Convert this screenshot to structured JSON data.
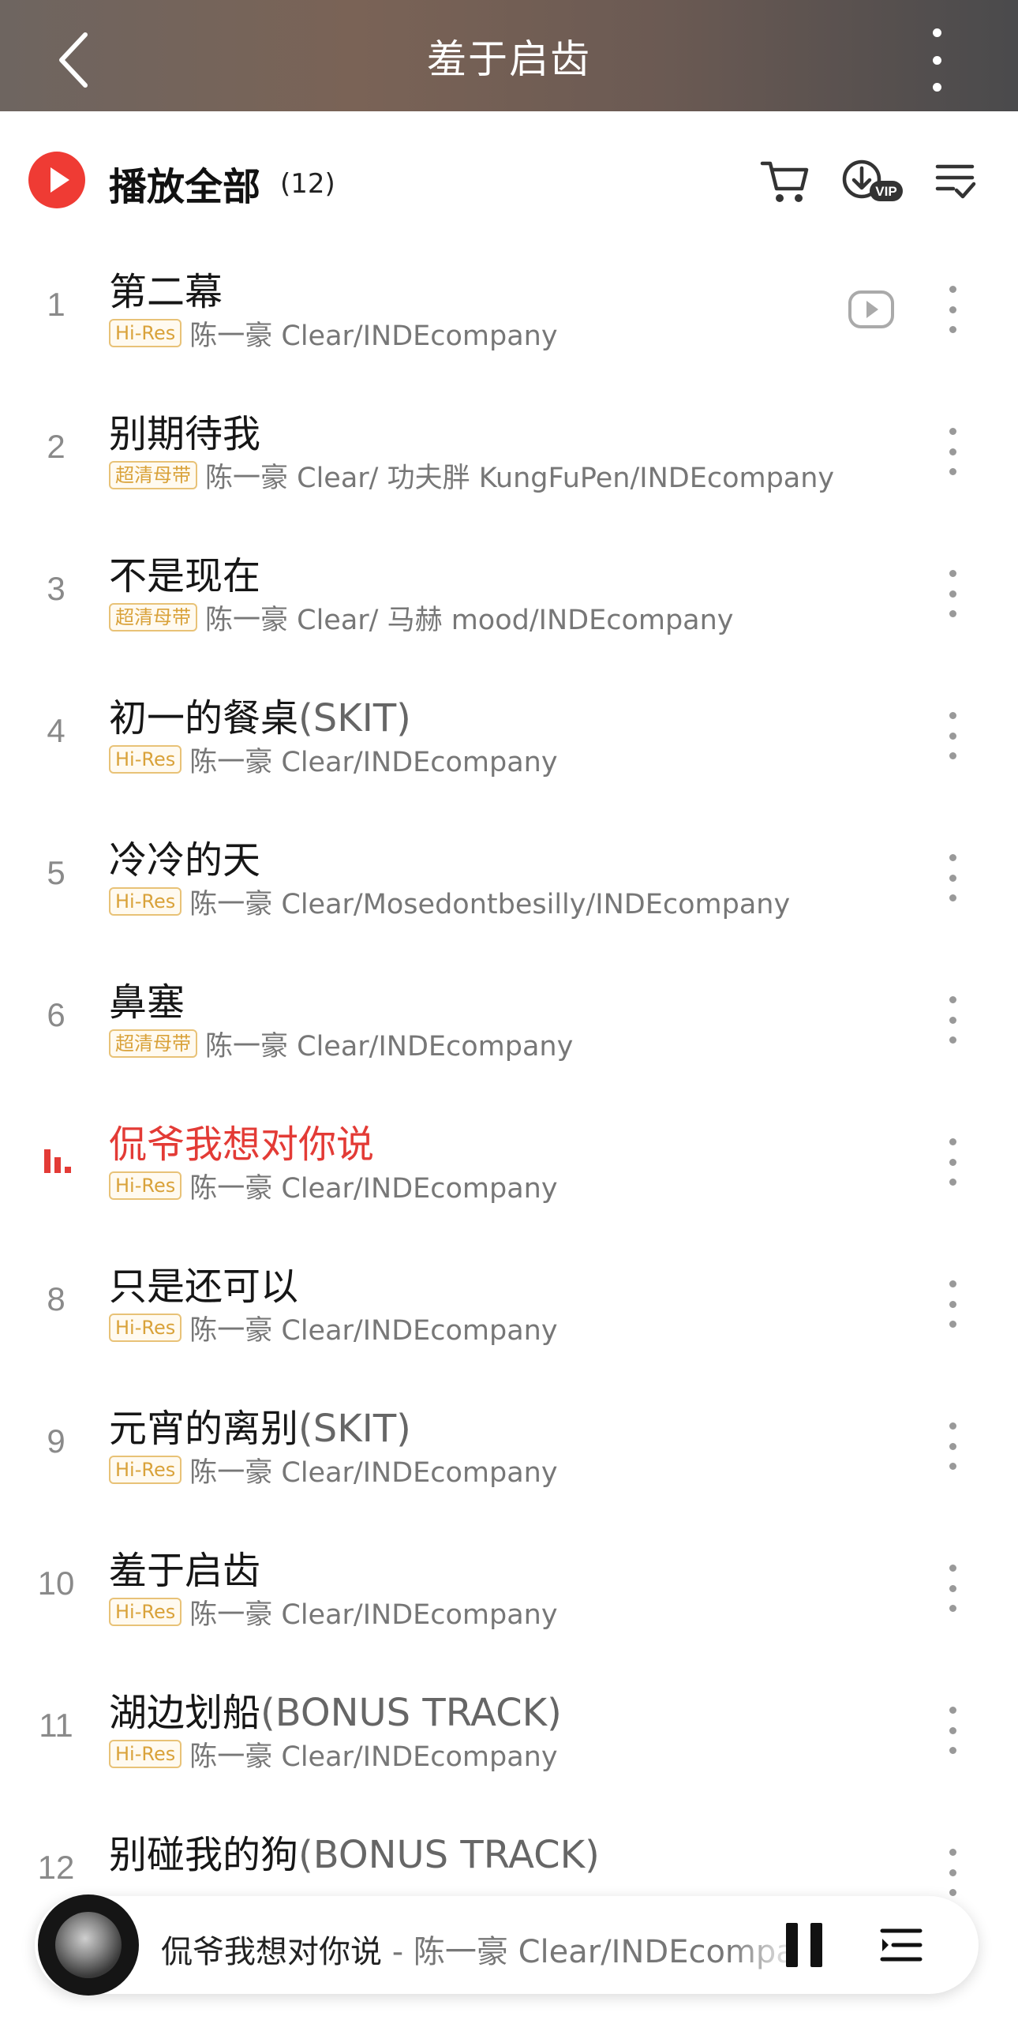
{
  "header": {
    "title": "羞于启齿"
  },
  "play_all": {
    "label": "播放全部",
    "count": "(12)"
  },
  "tracks": [
    {
      "number": "1",
      "title": "第二幕",
      "paren": "",
      "badge": "Hi-Res",
      "artist": "陈一豪 Clear/INDEcompany",
      "has_mv": true
    },
    {
      "number": "2",
      "title": "别期待我",
      "paren": "",
      "badge": "超清母带",
      "artist": "陈一豪 Clear/ 功夫胖 KungFuPen/INDEcompany"
    },
    {
      "number": "3",
      "title": "不是现在",
      "paren": "",
      "badge": "超清母带",
      "artist": "陈一豪 Clear/ 马赫 mood/INDEcompany"
    },
    {
      "number": "4",
      "title": "初一的餐桌",
      "paren": "(SKIT)",
      "badge": "Hi-Res",
      "artist": "陈一豪 Clear/INDEcompany"
    },
    {
      "number": "5",
      "title": "冷冷的天",
      "paren": "",
      "badge": "Hi-Res",
      "artist": "陈一豪 Clear/Mosedontbesilly/INDEcompany"
    },
    {
      "number": "6",
      "title": "鼻塞",
      "paren": "",
      "badge": "超清母带",
      "artist": "陈一豪 Clear/INDEcompany"
    },
    {
      "number": "7",
      "title": "侃爷我想对你说",
      "paren": "",
      "badge": "Hi-Res",
      "artist": "陈一豪 Clear/INDEcompany",
      "playing": true
    },
    {
      "number": "8",
      "title": "只是还可以",
      "paren": "",
      "badge": "Hi-Res",
      "artist": "陈一豪 Clear/INDEcompany"
    },
    {
      "number": "9",
      "title": "元宵的离别",
      "paren": "(SKIT)",
      "badge": "Hi-Res",
      "artist": "陈一豪 Clear/INDEcompany"
    },
    {
      "number": "10",
      "title": "羞于启齿",
      "paren": "",
      "badge": "Hi-Res",
      "artist": "陈一豪 Clear/INDEcompany"
    },
    {
      "number": "11",
      "title": "湖边划船",
      "paren": "(BONUS TRACK)",
      "badge": "Hi-Res",
      "artist": "陈一豪 Clear/INDEcompany"
    },
    {
      "number": "12",
      "title": "别碰我的狗",
      "paren": "(BONUS TRACK)",
      "badge": "",
      "artist": ""
    }
  ],
  "mini_player": {
    "title": "侃爷我想对你说",
    "separator": " - ",
    "artist": "陈一豪 Clear/INDEcompany"
  },
  "icons": {
    "back": "chevron-left-icon",
    "more": "more-vertical-icon",
    "cart": "cart-icon",
    "download": "download-vip-icon",
    "multiselect": "list-check-icon",
    "mv": "video-play-icon",
    "pause": "pause-icon",
    "playlist": "playlist-icon"
  },
  "colors": {
    "accent": "#e33b36",
    "badge": "#d9a23a"
  }
}
